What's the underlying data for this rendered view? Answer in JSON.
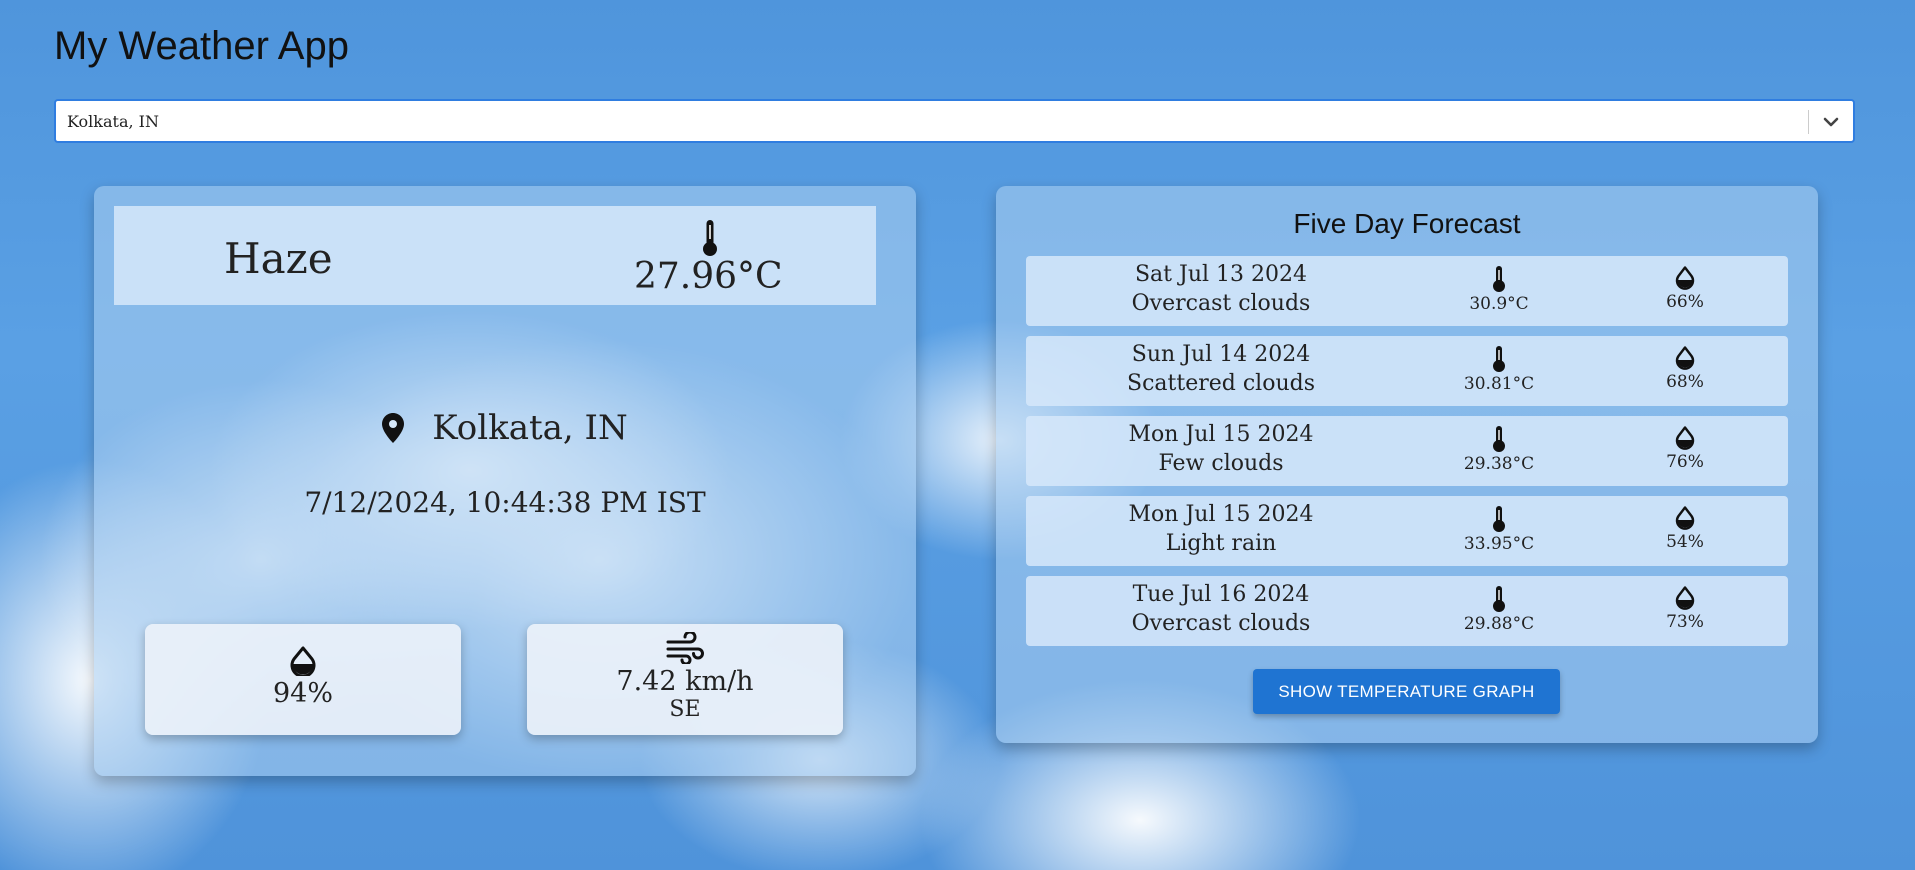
{
  "app": {
    "title": "My Weather App"
  },
  "search": {
    "selected_city": "Kolkata, IN"
  },
  "current": {
    "condition": "Haze",
    "temperature": "27.96°C",
    "location": "Kolkata, IN",
    "datetime": "7/12/2024, 10:44:38 PM IST",
    "humidity": "94%",
    "wind_speed": "7.42 km/h",
    "wind_direction": "SE"
  },
  "forecast": {
    "title": "Five Day Forecast",
    "days": [
      {
        "date": "Sat Jul 13 2024",
        "description": "Overcast clouds",
        "temp": "30.9°C",
        "humidity": "66%"
      },
      {
        "date": "Sun Jul 14 2024",
        "description": "Scattered clouds",
        "temp": "30.81°C",
        "humidity": "68%"
      },
      {
        "date": "Mon Jul 15 2024",
        "description": "Few clouds",
        "temp": "29.38°C",
        "humidity": "76%"
      },
      {
        "date": "Mon Jul 15 2024",
        "description": "Light rain",
        "temp": "33.95°C",
        "humidity": "54%"
      },
      {
        "date": "Tue Jul 16 2024",
        "description": "Overcast clouds",
        "temp": "29.88°C",
        "humidity": "73%"
      }
    ],
    "button_label": "SHOW TEMPERATURE GRAPH"
  },
  "icons": {
    "thermometer": "thermometer-icon",
    "humidity": "water-drop-icon",
    "wind": "wind-icon",
    "location": "location-pin-icon",
    "dropdown": "chevron-down-icon"
  },
  "colors": {
    "button": "#1f74d2",
    "select_border": "#2f7de0"
  }
}
